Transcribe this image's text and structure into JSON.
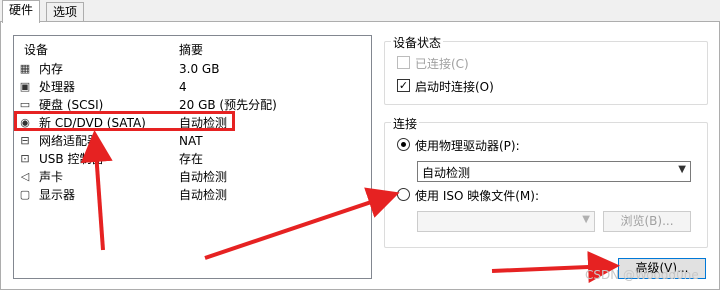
{
  "tabs": [
    {
      "label": "硬件",
      "active": true
    },
    {
      "label": "选项",
      "active": false
    }
  ],
  "device_list": {
    "headers": {
      "device": "设备",
      "summary": "摘要"
    },
    "rows": [
      {
        "icon": "memory-icon",
        "name": "内存",
        "summary": "3.0 GB"
      },
      {
        "icon": "processor-icon",
        "name": "处理器",
        "summary": "4"
      },
      {
        "icon": "harddisk-icon",
        "name": "硬盘 (SCSI)",
        "summary": "20 GB (预先分配)"
      },
      {
        "icon": "cd-dvd-icon",
        "name": "新 CD/DVD (SATA)",
        "summary": "自动检测",
        "selected": true
      },
      {
        "icon": "network-adapter-icon",
        "name": "网络适配器",
        "summary": "NAT"
      },
      {
        "icon": "usb-icon",
        "name": "USB 控制器",
        "summary": "存在"
      },
      {
        "icon": "sound-card-icon",
        "name": "声卡",
        "summary": "自动检测"
      },
      {
        "icon": "display-icon",
        "name": "显示器",
        "summary": "自动检测"
      }
    ]
  },
  "device_status": {
    "title": "设备状态",
    "connected_label": "已连接(C)",
    "connected_checked": false,
    "connect_at_power_on_label": "启动时连接(O)",
    "connect_at_power_on_checked": true
  },
  "connection": {
    "title": "连接",
    "physical_drive_label": "使用物理驱动器(P):",
    "physical_drive_selected": true,
    "physical_drive_value": "自动检测",
    "iso_label": "使用 ISO 映像文件(M):",
    "iso_selected": false,
    "iso_value": "",
    "browse_label": "浏览(B)..."
  },
  "advanced_label": "高级(V)...",
  "watermark": "CSDN @Woodd0ne",
  "colors": {
    "annotation": "#e62222",
    "accent": "#0078d7"
  }
}
